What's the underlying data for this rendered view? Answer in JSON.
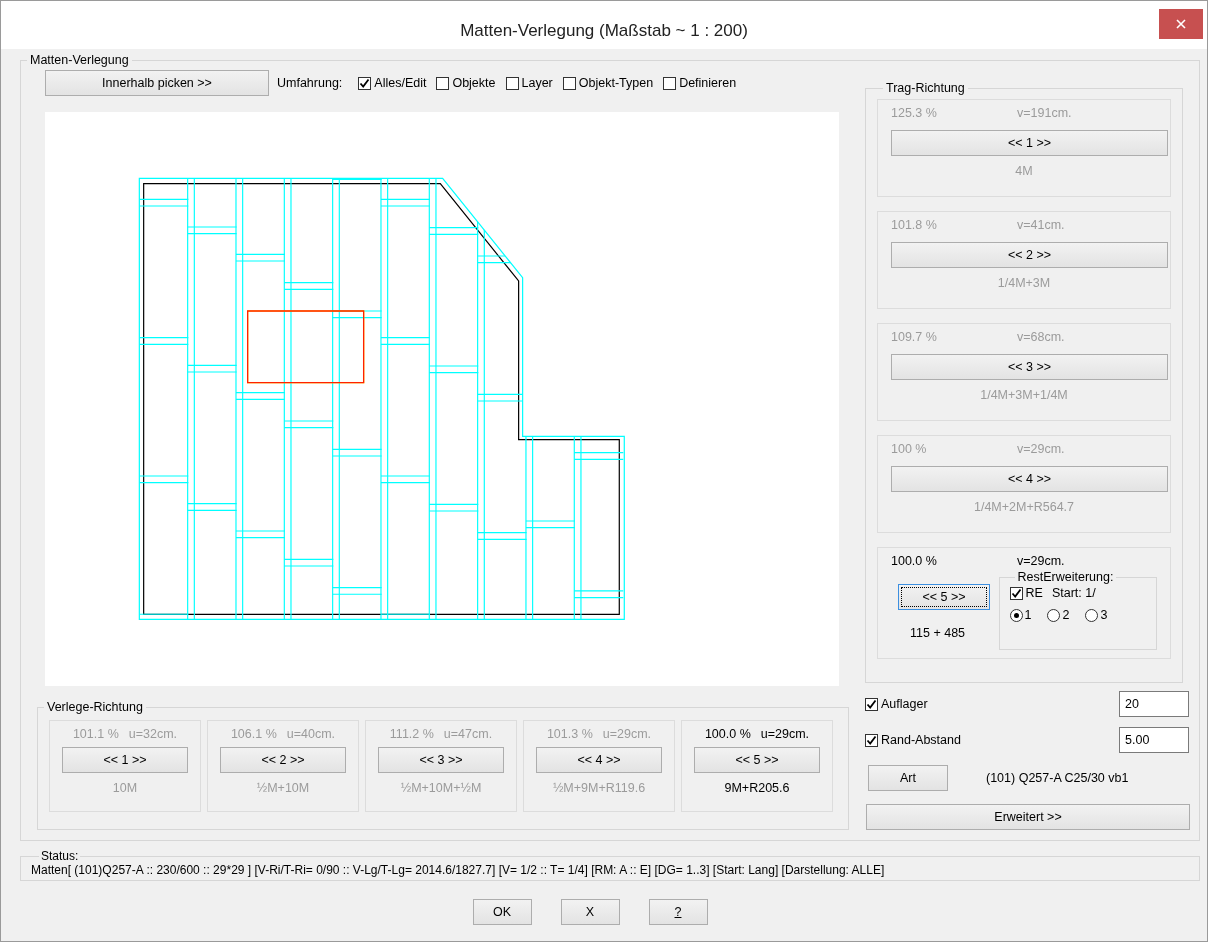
{
  "window": {
    "title": "Matten-Verlegung (Maßstab ~ 1 : 200)"
  },
  "main_group": {
    "title": "Matten-Verlegung",
    "pick_button": "Innerhalb picken >>",
    "umfahrung_label": "Umfahrung:",
    "filters": [
      {
        "label": "Alles/Edit",
        "checked": true
      },
      {
        "label": "Objekte",
        "checked": false
      },
      {
        "label": "Layer",
        "checked": false
      },
      {
        "label": "Objekt-Typen",
        "checked": false
      },
      {
        "label": "Definieren",
        "checked": false
      }
    ],
    "verlege_richtung": {
      "title": "Verlege-Richtung",
      "options": [
        {
          "percent": "101.1 %",
          "u": "u=32cm.",
          "button": "<< 1 >>",
          "result": "10M",
          "selected": false
        },
        {
          "percent": "106.1 %",
          "u": "u=40cm.",
          "button": "<< 2 >>",
          "result": "½M+10M",
          "selected": false
        },
        {
          "percent": "111.2 %",
          "u": "u=47cm.",
          "button": "<< 3 >>",
          "result": "½M+10M+½M",
          "selected": false
        },
        {
          "percent": "101.3 %",
          "u": "u=29cm.",
          "button": "<< 4 >>",
          "result": "½M+9M+R119.6",
          "selected": false
        },
        {
          "percent": "100.0 %",
          "u": "u=29cm.",
          "button": "<< 5 >>",
          "result": "9M+R205.6",
          "selected": true
        }
      ]
    },
    "trag_richtung": {
      "title": "Trag-Richtung",
      "options": [
        {
          "percent": "125.3 %",
          "v": "v=191cm.",
          "button": "<< 1 >>",
          "result": "4M",
          "selected": false
        },
        {
          "percent": "101.8 %",
          "v": "v=41cm.",
          "button": "<< 2 >>",
          "result": "1/4M+3M",
          "selected": false
        },
        {
          "percent": "109.7 %",
          "v": "v=68cm.",
          "button": "<< 3 >>",
          "result": "1/4M+3M+1/4M",
          "selected": false
        },
        {
          "percent": "100 %",
          "v": "v=29cm.",
          "button": "<< 4 >>",
          "result": "1/4M+2M+R564.7",
          "selected": false
        },
        {
          "percent": "100.0 %",
          "v": "v=29cm.",
          "button": "<< 5 >>",
          "result": "115 + 485",
          "selected": true
        }
      ],
      "rest_erweiterung": {
        "title": "RestErweiterung:",
        "re": {
          "label": "RE",
          "checked": true
        },
        "start_label": "Start: 1/",
        "radios": [
          {
            "label": "1",
            "selected": true
          },
          {
            "label": "2",
            "selected": false
          },
          {
            "label": "3",
            "selected": false
          }
        ]
      }
    },
    "auflager": {
      "label": "Auflager",
      "checked": true,
      "value": "20"
    },
    "rand_abstand": {
      "label": "Rand-Abstand",
      "checked": true,
      "value": "5.00"
    },
    "art_button": "Art",
    "art_value": "(101) Q257-A C25/30 vb1",
    "erweitert_button": "Erweitert >>"
  },
  "status": {
    "title": "Status:",
    "text": "Matten[ (101)Q257-A :: 230/600 :: 29*29 ] [V-Ri/T-Ri= 0/90 :: V-Lg/T-Lg= 2014.6/1827.7] [V= 1/2 :: T= 1/4] [RM: A :: E] [DG= 1..3] [Start: Lang] [Darstellung: ALLE]"
  },
  "buttons": [
    {
      "label": "OK",
      "underlined": false
    },
    {
      "label": "X",
      "underlined": false
    },
    {
      "label": "?",
      "underlined": true
    }
  ]
}
